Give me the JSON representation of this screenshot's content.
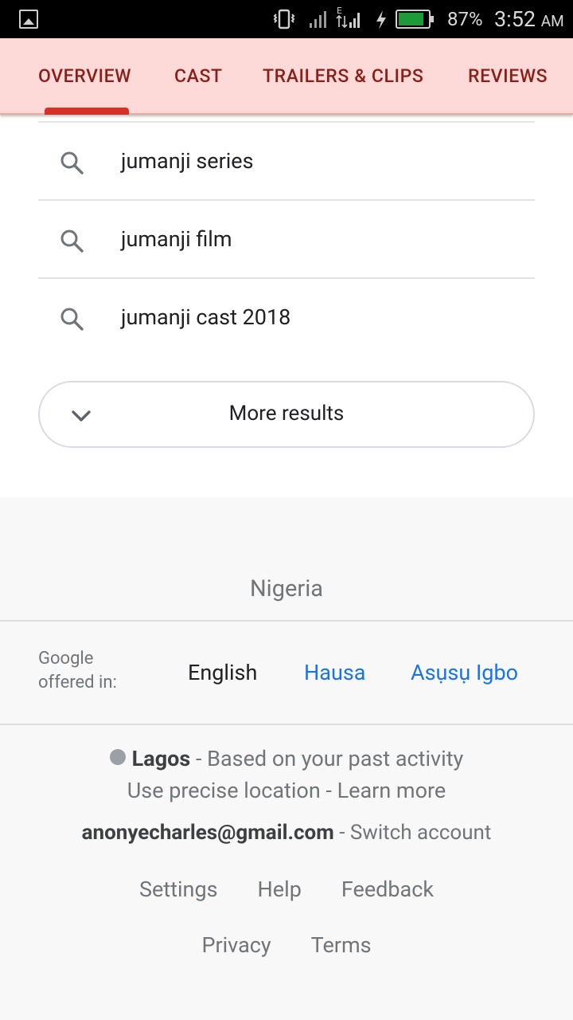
{
  "status_bar": {
    "battery_percent": "87%",
    "battery_level": 0.87,
    "time": "3:52",
    "ampm": "AM",
    "icons": [
      "gallery-icon",
      "vibrate-icon",
      "signal-icon",
      "signal-e-icon",
      "charging-icon",
      "battery-icon"
    ]
  },
  "tabs": [
    {
      "label": "OVERVIEW",
      "selected": true
    },
    {
      "label": "CAST",
      "selected": false
    },
    {
      "label": "TRAILERS & CLIPS",
      "selected": false
    },
    {
      "label": "REVIEWS",
      "selected": false
    }
  ],
  "suggestions": [
    {
      "text": "jumanji series",
      "icon": "search-icon"
    },
    {
      "text": "jumanji film",
      "icon": "search-icon"
    },
    {
      "text": "jumanji cast 2018",
      "icon": "search-icon"
    }
  ],
  "more_results": {
    "label": "More results",
    "icon": "chevron-down-icon"
  },
  "footer": {
    "country": "Nigeria",
    "offered_in_line1": "Google",
    "offered_in_line2": "offered in:",
    "languages": [
      {
        "label": "English",
        "current": true
      },
      {
        "label": "Hausa",
        "current": false
      },
      {
        "label": "Asụsụ Igbo",
        "current": false
      }
    ],
    "location_city": "Lagos",
    "location_suffix": "- Based on your past activity",
    "precise_location": "Use precise location",
    "learn_more": "Learn more",
    "separator": "-",
    "account_email": "anonyecharles@gmail.com",
    "switch_account": "- Switch account",
    "links_row1": [
      "Settings",
      "Help",
      "Feedback"
    ],
    "links_row2": [
      "Privacy",
      "Terms"
    ]
  },
  "colors": {
    "tab_bar_bg": "#fdd9d7",
    "tab_text": "#8a1f1a",
    "tab_indicator": "#d93025",
    "link_blue": "#1a73e8",
    "footer_bg": "#f8f8f8"
  }
}
